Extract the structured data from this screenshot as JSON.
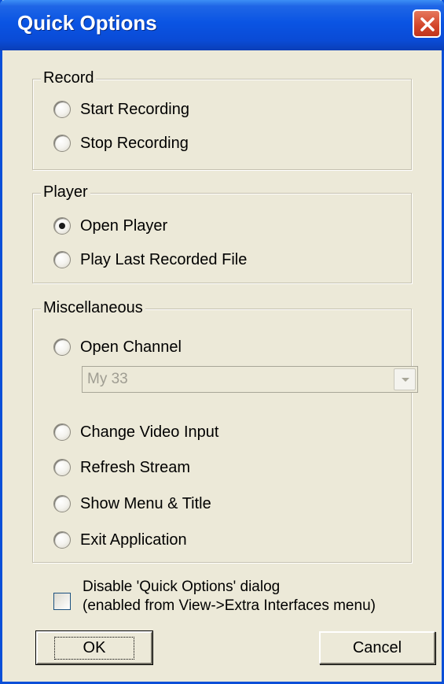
{
  "window": {
    "title": "Quick Options"
  },
  "record": {
    "legend": "Record",
    "options": [
      {
        "label": "Start Recording",
        "checked": false
      },
      {
        "label": "Stop Recording",
        "checked": false
      }
    ]
  },
  "player": {
    "legend": "Player",
    "options": [
      {
        "label": "Open Player",
        "checked": true
      },
      {
        "label": "Play Last Recorded File",
        "checked": false
      }
    ]
  },
  "misc": {
    "legend": "Miscellaneous",
    "open_channel": {
      "label": "Open Channel",
      "checked": false
    },
    "channel_select": {
      "value": "My 33",
      "disabled": true
    },
    "options": [
      {
        "label": "Change Video Input",
        "checked": false
      },
      {
        "label": "Refresh Stream",
        "checked": false
      },
      {
        "label": "Show Menu & Title",
        "checked": false
      },
      {
        "label": "Exit Application",
        "checked": false
      }
    ]
  },
  "disable_checkbox": {
    "line1": "Disable 'Quick Options' dialog",
    "line2": "(enabled from View->Extra Interfaces menu)",
    "checked": false
  },
  "buttons": {
    "ok": "OK",
    "cancel": "Cancel"
  },
  "icons": {
    "close": "close-icon",
    "dropdown": "chevron-down-icon"
  },
  "colors": {
    "titlebar": "#0a54e3",
    "window_bg": "#ece9d8",
    "close_button": "#d2452a"
  }
}
